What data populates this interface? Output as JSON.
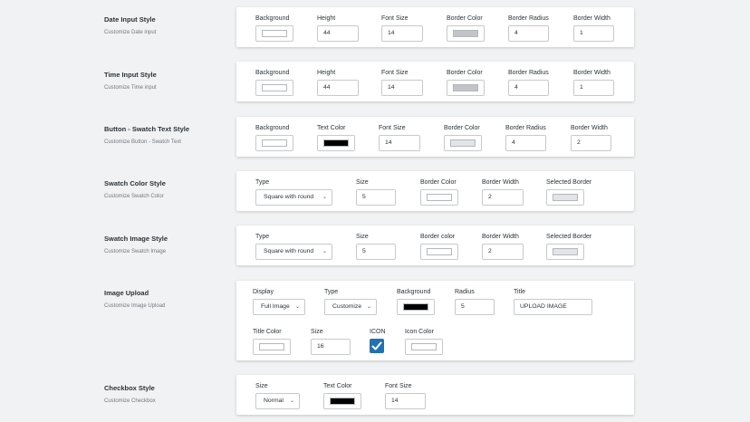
{
  "colors": {
    "white_swatch": "#ffffff",
    "gray_swatch": "#c3c4c7",
    "light_gray_swatch": "#e2e4e7",
    "black_swatch": "#000000",
    "checkbox_accent": "#2271b1"
  },
  "date_input": {
    "title": "Date Input Style",
    "desc": "Customize Date input",
    "background_label": "Background",
    "height_label": "Height",
    "height_value": "44",
    "font_size_label": "Font Size",
    "font_size_value": "14",
    "border_color_label": "Border Color",
    "border_radius_label": "Border Radius",
    "border_radius_value": "4",
    "border_width_label": "Border Width",
    "border_width_value": "1"
  },
  "time_input": {
    "title": "Time Input Style",
    "desc": "Customize Time input",
    "background_label": "Background",
    "height_label": "Height",
    "height_value": "44",
    "font_size_label": "Font Size",
    "font_size_value": "14",
    "border_color_label": "Border Color",
    "border_radius_label": "Border Radius",
    "border_radius_value": "4",
    "border_width_label": "Border Width",
    "border_width_value": "1"
  },
  "swatch_text": {
    "title": "Button - Swatch Text Style",
    "desc": "Customize Button - Swatch Text",
    "background_label": "Background",
    "text_color_label": "Text Color",
    "font_size_label": "Font Size",
    "font_size_value": "14",
    "border_color_label": "Border Color",
    "border_radius_label": "Border Radius",
    "border_radius_value": "4",
    "border_width_label": "Border Width",
    "border_width_value": "2"
  },
  "swatch_color": {
    "title": "Swatch Color Style",
    "desc": "Customize Swatch Color",
    "type_label": "Type",
    "type_value": "Square with round",
    "size_label": "Size",
    "size_value": "5",
    "border_color_label": "Border Color",
    "border_width_label": "Border Width",
    "border_width_value": "2",
    "selected_border_label": "Selected Border"
  },
  "swatch_image": {
    "title": "Swatch Image Style",
    "desc": "Customize Swatch Image",
    "type_label": "Type",
    "type_value": "Square with round",
    "size_label": "Size",
    "size_value": "5",
    "border_color_label": "Border color",
    "border_width_label": "Border Width",
    "border_width_value": "2",
    "selected_border_label": "Selected Border"
  },
  "image_upload": {
    "title": "Image Upload",
    "desc": "Customize Image Upload",
    "display_label": "Display",
    "display_value": "Full Image",
    "type_label": "Type",
    "type_value": "Customize",
    "background_label": "Background",
    "radius_label": "Radius",
    "radius_value": "5",
    "title_label": "Title",
    "title_value": "UPLOAD IMAGE",
    "title_color_label": "Title Color",
    "size_label": "Size",
    "size_value": "16",
    "icon_label": "ICON",
    "icon_checked": true,
    "icon_color_label": "Icon Color"
  },
  "checkbox_style": {
    "title": "Checkbox Style",
    "desc": "Customize Checkbox",
    "size_label": "Size",
    "size_value": "Normal",
    "text_color_label": "Text Color",
    "font_size_label": "Font Size",
    "font_size_value": "14"
  }
}
